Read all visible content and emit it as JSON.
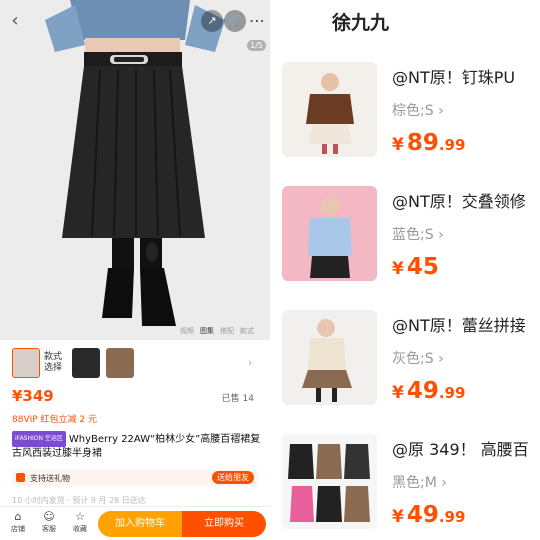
{
  "left": {
    "image_counter": "1/5",
    "media_tabs": [
      "视频",
      "图集",
      "搭配",
      "款式"
    ],
    "media_tab_active": "图集",
    "variant_label_line1": "款式",
    "variant_label_line2": "选择",
    "price": "¥349",
    "sold": "已售 14",
    "vip_note": "88VIP 红包立减 2 元",
    "ifashion_badge": "iFASHION 空运区",
    "title": "WhyBerry 22AW“柏林少女”高腰百褶裙复古风西装过膝半身裙",
    "gift_text": "支持送礼物",
    "gift_button": "送给朋友",
    "faded_line": "10 小时内发货 · 预计 9 月 28 日送达",
    "bottom": {
      "shop": "店铺",
      "service": "客服",
      "fav": "收藏",
      "add_cart": "加入购物车",
      "buy_now": "立即购买"
    }
  },
  "right": {
    "shop_name": "徐九九",
    "items": [
      {
        "name": "@NT原！钉珠PU",
        "spec": "棕色;S",
        "price_int": "89",
        "price_dec": ".99"
      },
      {
        "name": "@NT原！交叠领修",
        "spec": "蓝色;S",
        "price_int": "45",
        "price_dec": ""
      },
      {
        "name": "@NT原！蕾丝拼接",
        "spec": "灰色;S",
        "price_int": "49",
        "price_dec": ".99"
      },
      {
        "name": "@原 349！ 高腰百",
        "spec": "黑色;M",
        "price_int": "49",
        "price_dec": ".99"
      }
    ],
    "currency": "¥",
    "chevron": "›"
  },
  "colors": {
    "accent": "#ff5000",
    "cart_button": "#ffa200",
    "ifashion": "#7b4bd6"
  }
}
